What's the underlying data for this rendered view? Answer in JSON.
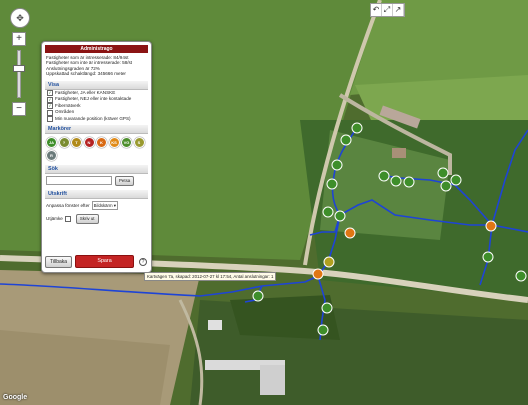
{
  "map": {
    "pan_label": "✥",
    "zoom_in": "+",
    "zoom_out": "−",
    "maptype_icons": [
      "↶",
      "⤢",
      "↗"
    ],
    "google_logo": "Google",
    "tooltip": "Kartvägen 7a, skapad: 2012-07-27 kl 17:54, Antal anslutningar: 1"
  },
  "panel": {
    "title": "Administrago",
    "info_lines": [
      "Fastigheter som är intresserade: 84/94st",
      "Fastigheter som inte är intresserade: 58/st",
      "Anslutningsgraden är 72%",
      "Uppskattad schaktlängd: 345666 meter"
    ],
    "visa": {
      "heading": "Visa",
      "items": [
        {
          "label": "Fastigheter, JA eller KANSKE",
          "checked": true
        },
        {
          "label": "Fastigheter, NEJ eller inte kontaktade",
          "checked": true
        },
        {
          "label": "Fibernätverk",
          "checked": true
        },
        {
          "label": "Områden",
          "checked": false
        },
        {
          "label": "Min nuvarande position (kräver GPS)",
          "checked": false
        }
      ]
    },
    "markorer": {
      "heading": "Markörer",
      "markers": [
        {
          "label": "JA",
          "color": "#3e8e2a"
        },
        {
          "label": "?",
          "color": "#7a8c30"
        },
        {
          "label": "T",
          "color": "#b08a1a"
        },
        {
          "label": "N",
          "color": "#b52222"
        },
        {
          "label": "K",
          "color": "#d86a14"
        },
        {
          "label": "KS",
          "color": "#e08a18"
        },
        {
          "label": "VG",
          "color": "#4c8e2c"
        },
        {
          "label": "S",
          "color": "#9a9a30"
        },
        {
          "label": "R",
          "color": "#6a7a7a"
        }
      ]
    },
    "sok": {
      "heading": "Sök",
      "button": "Petsa"
    },
    "utskrift": {
      "heading": "Utskrift",
      "fit_label": "Anpassa fönster efter",
      "fit_value": "Bildskärm ▾",
      "outline_label": "Utjämke",
      "outline_button": "Skriv ut"
    },
    "buttons": {
      "back": "Tillbaka",
      "save": "Spara",
      "help": "?"
    }
  }
}
